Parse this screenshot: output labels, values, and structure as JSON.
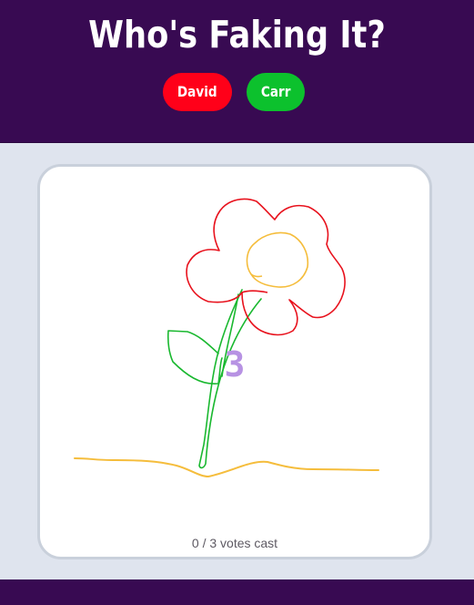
{
  "header": {
    "title": "Who's Faking It?",
    "players": [
      {
        "name": "David",
        "color": "#ff0019"
      },
      {
        "name": "Carr",
        "color": "#0cc12d"
      }
    ]
  },
  "card": {
    "countdown": "3",
    "votes_text": "0 / 3 votes cast"
  },
  "colors": {
    "header_bg": "#380a52",
    "page_bg": "#dfe4ee",
    "stroke_red": "#e8121d",
    "stroke_yellow": "#f5bd3c",
    "stroke_green": "#19b82f",
    "countdown": "#b792e3"
  }
}
